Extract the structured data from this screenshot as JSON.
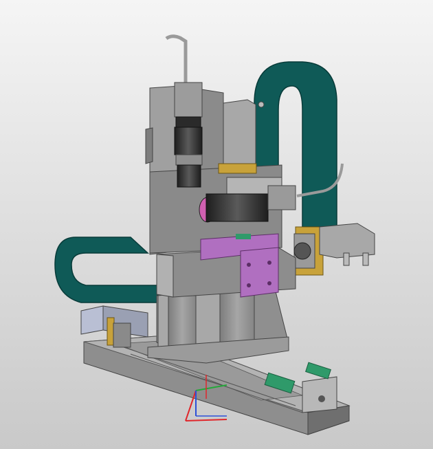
{
  "viewport": {
    "background_top": "#f5f5f5",
    "background_bottom": "#c9c9c9"
  },
  "model": {
    "body_color": "#9a9a9a",
    "body_dark": "#6f6f6f",
    "body_light": "#c4c4c4",
    "cable_chain_color": "#0f5a57",
    "cable_chain_dark": "#0a3f3d",
    "bracket_color": "#b06fc0",
    "brass_color": "#c8a23a",
    "lens_dark": "#2a2a2a",
    "lens_ring": "#9c9c9c",
    "green_block": "#2f9a6a"
  },
  "axes_triad": {
    "x_color": "#e0262b",
    "y_color": "#25a83a",
    "z_color": "#2c4fd8"
  }
}
